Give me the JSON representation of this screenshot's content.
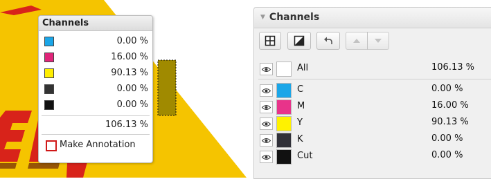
{
  "popup": {
    "title": "Channels",
    "rows": [
      {
        "color": "#1aa6e8",
        "value": "0.00 %"
      },
      {
        "color": "#e0257a",
        "value": "16.00 %"
      },
      {
        "color": "#ffee00",
        "value": "90.13 %"
      },
      {
        "color": "#333333",
        "value": "0.00 %"
      },
      {
        "color": "#111111",
        "value": "0.00 %"
      }
    ],
    "total": "106.13 %",
    "annotation_label": "Make Annotation"
  },
  "panel": {
    "title": "Channels",
    "toolbar": {
      "icons": [
        "grid-icon",
        "contrast-icon",
        "undo-icon",
        "arrow-up-icon",
        "arrow-down-icon"
      ]
    },
    "all": {
      "name": "All",
      "value": "106.13 %",
      "color": "#ffffff"
    },
    "channels": [
      {
        "name": "C",
        "value": "0.00 %",
        "color": "#1aa6e8"
      },
      {
        "name": "M",
        "value": "16.00 %",
        "color": "#e8338a"
      },
      {
        "name": "Y",
        "value": "90.13 %",
        "color": "#fff200"
      },
      {
        "name": "K",
        "value": "0.00 %",
        "color": "#303038"
      },
      {
        "name": "Cut",
        "value": "0.00 %",
        "color": "#111111"
      }
    ]
  },
  "colors": {
    "artwork_yellow": "#f5c400",
    "artwork_red": "#d8231a",
    "annotation_red": "#d01818"
  }
}
